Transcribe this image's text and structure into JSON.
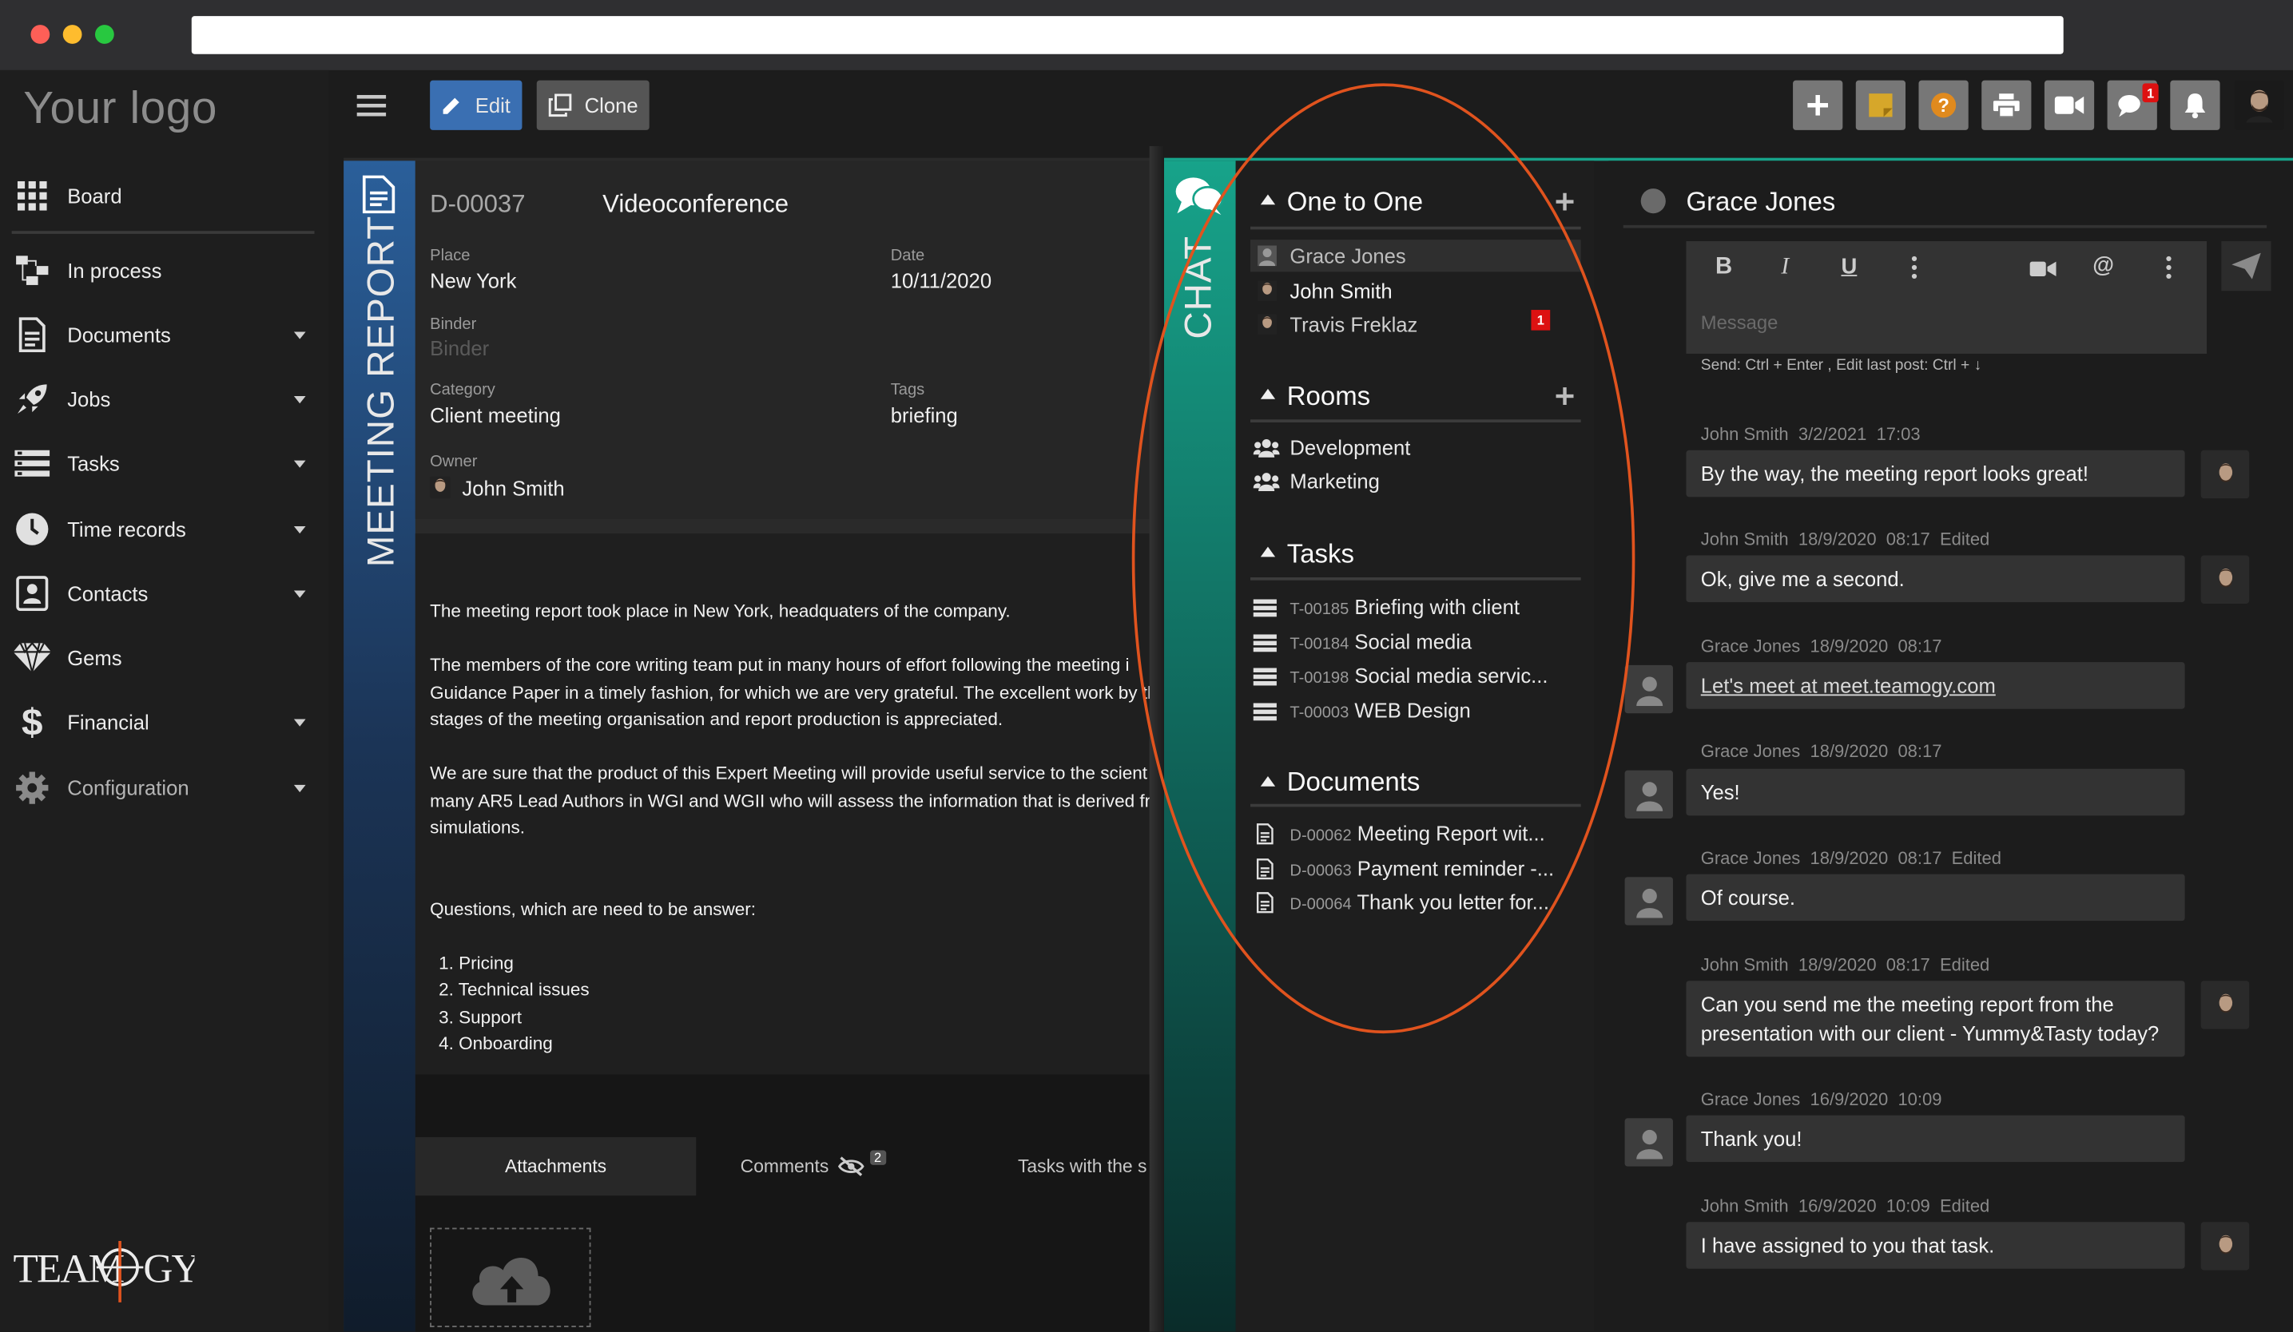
{
  "app": {
    "logo_text": "Your logo",
    "brand": "TEAMOGY"
  },
  "sidebar": {
    "items": [
      {
        "label": "Board",
        "icon": "grid-icon",
        "caret": false
      },
      {
        "label": "In process",
        "icon": "flow-icon",
        "caret": false
      },
      {
        "label": "Documents",
        "icon": "document-icon",
        "caret": true
      },
      {
        "label": "Jobs",
        "icon": "rocket-icon",
        "caret": true
      },
      {
        "label": "Tasks",
        "icon": "tasks-icon",
        "caret": true
      },
      {
        "label": "Time records",
        "icon": "clock-icon",
        "caret": true
      },
      {
        "label": "Contacts",
        "icon": "contact-card-icon",
        "caret": true
      },
      {
        "label": "Gems",
        "icon": "diamond-icon",
        "caret": false
      },
      {
        "label": "Financial",
        "icon": "dollar-icon",
        "caret": true
      },
      {
        "label": "Configuration",
        "icon": "gear-icon",
        "caret": true
      }
    ]
  },
  "toolbar": {
    "edit_label": "Edit",
    "clone_label": "Clone",
    "chat_badge": "1",
    "colors": {
      "edit": "#3a6fb2",
      "clone": "#555555",
      "plus": "#777777",
      "note": "#d6a72a",
      "help": "#e08a1e"
    }
  },
  "document": {
    "vertical_label": "MEETING REPORT",
    "id": "D-00037",
    "title": "Videoconference",
    "place_label": "Place",
    "place_value": "New York",
    "date_label": "Date",
    "date_value": "10/11/2020",
    "binder_label": "Binder",
    "binder_placeholder": "Binder",
    "category_label": "Category",
    "category_value": "Client meeting",
    "tags_label": "Tags",
    "tags_value": "briefing",
    "owner_label": "Owner",
    "owner_value": "John Smith",
    "body": {
      "p1": "The meeting report took place in New York, headquaters of the company.",
      "p2a": " The members of the core writing team put in many hours of effort following the meeting i",
      "p2b": "Guidance Paper in a timely fashion, for which we are very grateful. The excellent work by tl",
      "p2c": "stages of the meeting organisation and report production is appreciated.",
      "p3a": "We are sure that the product of this Expert Meeting will provide useful service to the scient",
      "p3b": "many AR5 Lead Authors in WGI and WGII who will assess the information that is derived fr",
      "p3c": "simulations.",
      "q": "Questions, which are need to be answer:",
      "list": [
        "1. Pricing",
        "2. Technical issues",
        "3. Support",
        "4. Onboarding"
      ]
    },
    "tabs": {
      "attachments": "Attachments",
      "comments": "Comments",
      "comments_count": "2",
      "tasks": "Tasks with the s"
    }
  },
  "chat": {
    "vertical_label": "CHAT",
    "one_to_one": {
      "title": "One to One",
      "items": [
        {
          "name": "Grace Jones",
          "badge": ""
        },
        {
          "name": "John Smith",
          "badge": ""
        },
        {
          "name": "Travis Freklaz",
          "badge": "1"
        }
      ]
    },
    "rooms": {
      "title": "Rooms",
      "items": [
        "Development",
        "Marketing"
      ]
    },
    "tasks": {
      "title": "Tasks",
      "items": [
        {
          "code": "T-00185",
          "name": "Briefing with client"
        },
        {
          "code": "T-00184",
          "name": "Social media"
        },
        {
          "code": "T-00198",
          "name": "Social media servic..."
        },
        {
          "code": "T-00003",
          "name": "WEB Design"
        }
      ]
    },
    "documents": {
      "title": "Documents",
      "items": [
        {
          "code": "D-00062",
          "name": "Meeting Report wit..."
        },
        {
          "code": "D-00063",
          "name": "Payment reminder -..."
        },
        {
          "code": "D-00064",
          "name": "Thank you letter for..."
        }
      ]
    },
    "conversation": {
      "partner": "Grace Jones",
      "message_placeholder": "Message",
      "hint": "Send: Ctrl + Enter , Edit last post: Ctrl + ↓",
      "messages": [
        {
          "author": "John Smith",
          "date": "3/2/2021",
          "time": "17:03",
          "edited": "",
          "text": "By the way, the meeting report looks great!",
          "text2": ""
        },
        {
          "author": "John Smith",
          "date": "18/9/2020",
          "time": "08:17",
          "edited": "Edited",
          "text": "Ok, give me a second.",
          "text2": ""
        },
        {
          "author": "Grace Jones",
          "date": "18/9/2020",
          "time": "08:17",
          "edited": "",
          "text": "Let's meet at meet.teamogy.com",
          "text2": ""
        },
        {
          "author": "Grace Jones",
          "date": "18/9/2020",
          "time": "08:17",
          "edited": "",
          "text": "Yes!",
          "text2": ""
        },
        {
          "author": "Grace Jones",
          "date": "18/9/2020",
          "time": "08:17",
          "edited": "Edited",
          "text": "Of course.",
          "text2": ""
        },
        {
          "author": "John Smith",
          "date": "18/9/2020",
          "time": "08:17",
          "edited": "Edited",
          "text": "Can you send me the meeting report from the",
          "text2": "presentation with our client - Yummy&Tasty today?"
        },
        {
          "author": "Grace Jones",
          "date": "16/9/2020",
          "time": "10:09",
          "edited": "",
          "text": "Thank you!",
          "text2": ""
        },
        {
          "author": "John Smith",
          "date": "16/9/2020",
          "time": "10:09",
          "edited": "Edited",
          "text": "I have assigned to you that task.",
          "text2": ""
        }
      ]
    }
  },
  "highlight_color": "#e0531e"
}
